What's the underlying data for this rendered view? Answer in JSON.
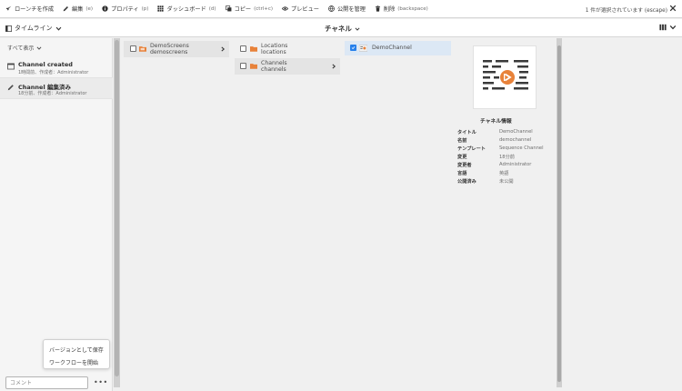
{
  "actionbar": {
    "create_launch": "ローンチを作成",
    "edit": "編集",
    "edit_key": "(e)",
    "properties": "プロパティ",
    "properties_key": "(p)",
    "dashboard": "ダッシュボード",
    "dashboard_key": "(d)",
    "copy": "コピー",
    "copy_key": "(ctrl+c)",
    "preview": "プレビュー",
    "manage_publication": "公開を管理",
    "delete": "削除",
    "delete_key": "(backspace)",
    "selection_info": "1 件が選択されています (escape)"
  },
  "subbar": {
    "rail_label": "タイムライン",
    "title": "チャネル"
  },
  "rail": {
    "filter": "すべて表示",
    "items": [
      {
        "title": "Channel created",
        "meta": "1時間前、作成者：Administrator",
        "icon": "channel-icon"
      },
      {
        "title": "Channel 編集済み",
        "meta": "18分前、作成者：Administrator",
        "icon": "pencil-icon"
      }
    ],
    "menu": {
      "save_version": "バージョンとして保存",
      "start_workflow": "ワークフローを開始"
    },
    "comment_placeholder": "コメント",
    "more": "•••"
  },
  "columns": {
    "col1": [
      {
        "title": "DemoScreens",
        "name": "demoscreens",
        "selected": true
      }
    ],
    "col2": [
      {
        "title": "Locations",
        "name": "locations",
        "selected": false
      },
      {
        "title": "Channels",
        "name": "channels",
        "selected": true
      }
    ],
    "col3": [
      {
        "title": "DemoChannel",
        "checked": true
      }
    ]
  },
  "details": {
    "info_title": "チャネル情報",
    "rows": [
      {
        "key": "タイトル",
        "value": "DemoChannel"
      },
      {
        "key": "名前",
        "value": "demochannel"
      },
      {
        "key": "テンプレート",
        "value": "Sequence Channel"
      },
      {
        "key": "変更",
        "value": "18分前"
      },
      {
        "key": "変更者",
        "value": "Administrator"
      },
      {
        "key": "言語",
        "value": "英語"
      },
      {
        "key": "公開済み",
        "value": "未公開"
      }
    ]
  },
  "colors": {
    "accent": "#2680eb",
    "folder": "#e8823a",
    "selected_row": "#e4e4e4",
    "checked_row": "#dce8f5"
  }
}
